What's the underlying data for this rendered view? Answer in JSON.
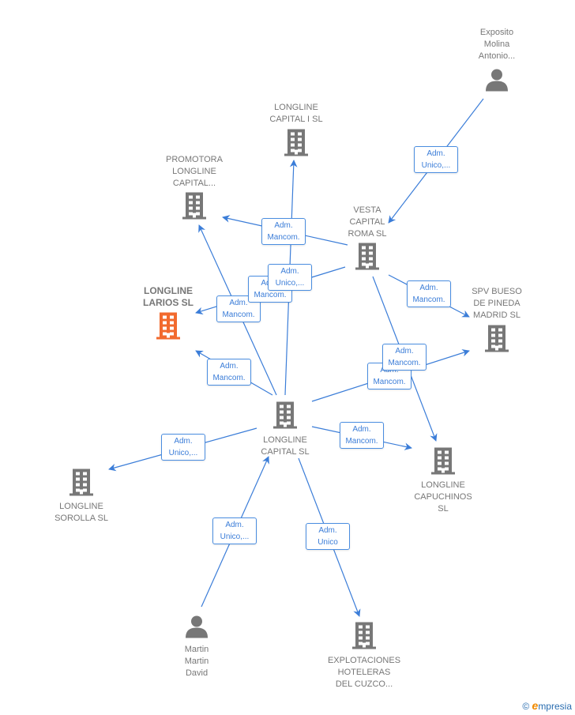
{
  "nodes": [
    {
      "id": "exposito",
      "type": "person",
      "lines": [
        "Exposito",
        "Molina",
        "Antonio..."
      ]
    },
    {
      "id": "capital1",
      "type": "company",
      "lines": [
        "LONGLINE",
        "CAPITAL I  SL"
      ]
    },
    {
      "id": "promotora",
      "type": "company",
      "lines": [
        "PROMOTORA",
        "LONGLINE",
        "CAPITAL..."
      ]
    },
    {
      "id": "vesta",
      "type": "company",
      "lines": [
        "VESTA",
        "CAPITAL",
        "ROMA  SL"
      ]
    },
    {
      "id": "larios",
      "type": "company-main",
      "lines": [
        "LONGLINE",
        "LARIOS  SL"
      ]
    },
    {
      "id": "spv",
      "type": "company",
      "lines": [
        "SPV BUESO",
        "DE PINEDA",
        "MADRID  SL"
      ]
    },
    {
      "id": "central",
      "type": "company",
      "lines": [
        "LONGLINE",
        "CAPITAL  SL"
      ]
    },
    {
      "id": "capuchinos",
      "type": "company",
      "lines": [
        "LONGLINE",
        "CAPUCHINOS",
        "SL"
      ]
    },
    {
      "id": "sorolla",
      "type": "company",
      "lines": [
        "LONGLINE",
        "SOROLLA  SL"
      ]
    },
    {
      "id": "martin",
      "type": "person",
      "lines": [
        "Martin",
        "Martin",
        "David"
      ]
    },
    {
      "id": "cuzco",
      "type": "company",
      "lines": [
        "EXPLOTACIONES",
        "HOTELERAS",
        "DEL CUZCO..."
      ]
    }
  ],
  "edges": [
    {
      "from": "exposito",
      "to": "vesta",
      "label": [
        "Adm.",
        "Unico,..."
      ]
    },
    {
      "from": "vesta",
      "to": "promotora",
      "label": [
        "Adm.",
        "Mancom."
      ]
    },
    {
      "from": "central",
      "to": "promotora",
      "label": [
        "Adm.",
        "Mancom."
      ]
    },
    {
      "from": "vesta",
      "to": "larios",
      "label": [
        "Adm.",
        "Mancom."
      ]
    },
    {
      "from": "central",
      "to": "capital1",
      "label": [
        "Adm.",
        "Unico,..."
      ]
    },
    {
      "from": "central",
      "to": "larios",
      "label": [
        "Adm.",
        "Mancom."
      ]
    },
    {
      "from": "central",
      "to": "spv",
      "label": [
        "Adm.",
        "Mancom."
      ]
    },
    {
      "from": "vesta",
      "to": "capuchinos",
      "label": [
        "Adm.",
        "Mancom."
      ]
    },
    {
      "from": "vesta",
      "to": "spv",
      "label": [
        "Adm.",
        "Mancom."
      ]
    },
    {
      "from": "central",
      "to": "capuchinos",
      "label": [
        "Adm.",
        "Mancom."
      ]
    },
    {
      "from": "central",
      "to": "sorolla",
      "label": [
        "Adm.",
        "Unico,..."
      ]
    },
    {
      "from": "martin",
      "to": "central",
      "label": [
        "Adm.",
        "Unico,..."
      ]
    },
    {
      "from": "central",
      "to": "cuzco",
      "label": [
        "Adm.",
        "Unico"
      ]
    }
  ],
  "colors": {
    "edge": "#3b7dd8",
    "company": "#777777",
    "main": "#f26a2e",
    "person": "#777777"
  },
  "footer": {
    "copyright": "©",
    "brand_initial": "e",
    "brand_rest": "mpresia"
  }
}
